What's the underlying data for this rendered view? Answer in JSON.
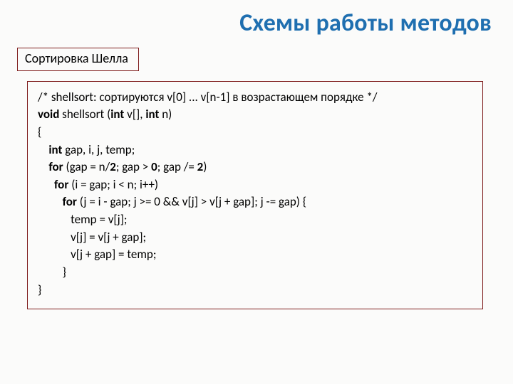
{
  "title": "Схемы работы методов",
  "label": "Сортировка Шелла",
  "code": {
    "l0": "/* shellsort: сортируются v[0] ... v[n-1] в возрастающем порядке */",
    "l1_a": "void",
    "l1_b": " shellsort (",
    "l1_c": "int",
    "l1_d": " v[], ",
    "l1_e": "int",
    "l1_f": " n)",
    "l2": "{",
    "l3_a": "    int",
    "l3_b": " gap, i, j, temp;",
    "l4_a": "    for ",
    "l4_b": "(gap = n/",
    "l4_c": "2",
    "l4_d": "; gap > ",
    "l4_e": "0",
    "l4_f": "; gap /= ",
    "l4_g": "2",
    "l4_h": ")",
    "l5_a": "      for ",
    "l5_b": "(i = gap; i < n; i++)",
    "l6_a": "         for ",
    "l6_b": "(j = i - gap; j >= 0 && v[j] > v[j + gap]; j -= gap) {",
    "l7": "            temp = v[j];",
    "l8": "            v[j] = v[j + gap];",
    "l9": "            v[j + gap] = temp;",
    "l10": "         }",
    "l11": "}"
  }
}
